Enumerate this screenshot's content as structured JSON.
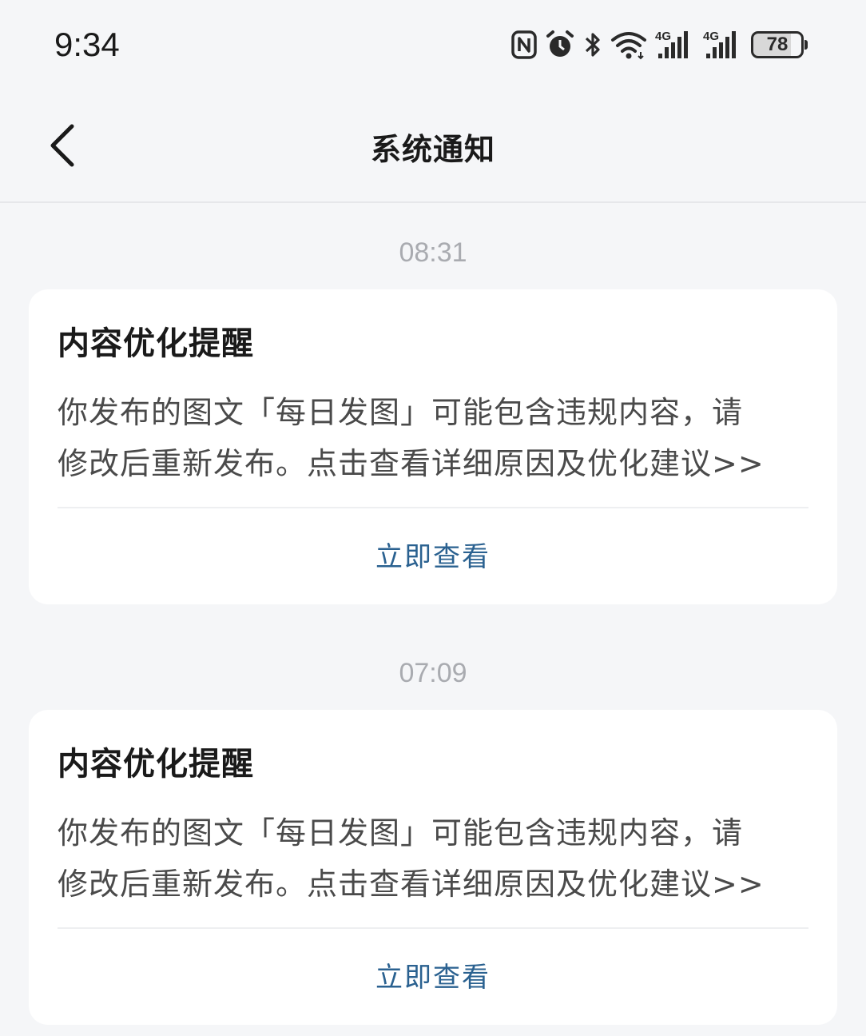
{
  "status_bar": {
    "time": "9:34",
    "icons": [
      "nfc-icon",
      "alarm-icon",
      "bluetooth-icon",
      "wifi-icon",
      "signal-4g-icon",
      "signal-4g-icon"
    ],
    "network_label_1": "4G",
    "network_label_2": "4G",
    "battery_level": "78"
  },
  "nav": {
    "title": "系统通知",
    "back_icon": "chevron-left-icon"
  },
  "notifications": [
    {
      "time": "08:31",
      "title": "内容优化提醒",
      "body_line1": "你发布的图文「每日发图」可能包含违规内容，请",
      "body_line2": "修改后重新发布。点击查看详细原因及优化建议>>",
      "action": "立即查看"
    },
    {
      "time": "07:09",
      "title": "内容优化提醒",
      "body_line1": "你发布的图文「每日发图」可能包含违规内容，请",
      "body_line2": "修改后重新发布。点击查看详细原因及优化建议>>",
      "action": "立即查看"
    }
  ],
  "colors": {
    "background": "#f5f6f8",
    "card": "#ffffff",
    "action_link": "#2a6190",
    "timestamp": "#a9abb0"
  }
}
